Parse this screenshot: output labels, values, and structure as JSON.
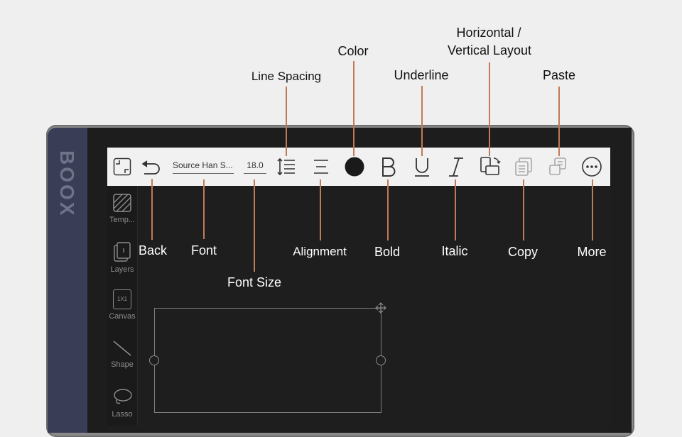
{
  "device": {
    "brand": "BOOX"
  },
  "toolbar": {
    "font_name": "Source Han S...",
    "font_size": "18.0"
  },
  "sidebar": {
    "items": [
      {
        "label": "Temp..."
      },
      {
        "label": "Layers"
      },
      {
        "label": "Canvas",
        "icon_text": "1X1"
      },
      {
        "label": "Shape"
      },
      {
        "label": "Lasso"
      }
    ]
  },
  "callouts": {
    "line_spacing": "Line Spacing",
    "color": "Color",
    "underline": "Underline",
    "layout_line1": "Horizontal /",
    "layout_line2": "Vertical Layout",
    "paste": "Paste",
    "back": "Back",
    "font": "Font",
    "font_size": "Font Size",
    "alignment": "Alignment",
    "bold": "Bold",
    "italic": "Italic",
    "copy": "Copy",
    "more": "More"
  }
}
